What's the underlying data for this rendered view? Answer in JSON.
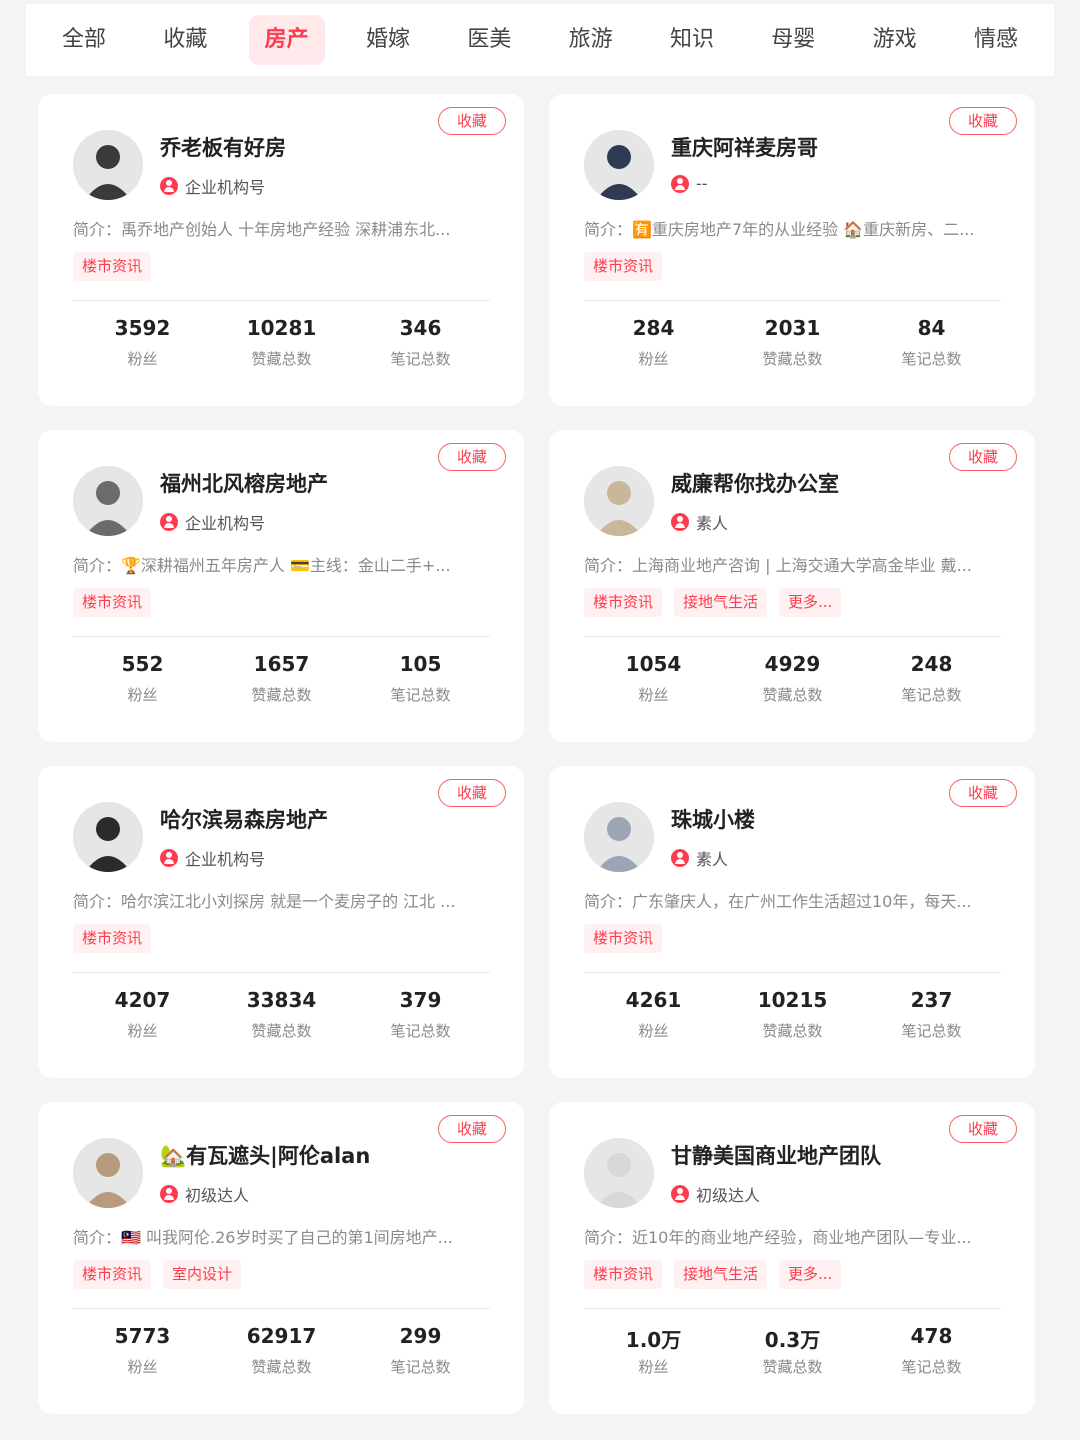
{
  "tabs": [
    "全部",
    "收藏",
    "房产",
    "婚嫁",
    "医美",
    "旅游",
    "知识",
    "母婴",
    "游戏",
    "情感"
  ],
  "active_tab_index": 2,
  "colors": {
    "accent": "#ff3b4e",
    "tag_bg": "#fff0f1",
    "page_bg": "#f4f4f5"
  },
  "collect_label": "收藏",
  "stat_labels": {
    "fans": "粉丝",
    "likes": "赞藏总数",
    "notes": "笔记总数"
  },
  "cards": [
    {
      "name": "乔老板有好房",
      "role": "企业机构号",
      "bio": "简介：禹乔地产创始人 十年房地产经验 深耕浦东北...",
      "tags": [
        "楼市资讯"
      ],
      "fans": "3592",
      "likes": "10281",
      "notes": "346",
      "avatar_color": "#3a3a3a"
    },
    {
      "name": "重庆阿祥麦房哥",
      "role": "--",
      "bio": "简介：🈶重庆房地产7年的从业经验 🏠重庆新房、二...",
      "tags": [
        "楼市资讯"
      ],
      "fans": "284",
      "likes": "2031",
      "notes": "84",
      "avatar_color": "#2f3b52"
    },
    {
      "name": "福州北风榕房地产",
      "role": "企业机构号",
      "bio": "简介：🏆深耕福州五年房产人 💳主线：金山二手+...",
      "tags": [
        "楼市资讯"
      ],
      "fans": "552",
      "likes": "1657",
      "notes": "105",
      "avatar_color": "#6b6b6b"
    },
    {
      "name": "威廉帮你找办公室",
      "role": "素人",
      "bio": "简介：上海商业地产咨询 | 上海交通大学高金毕业 戴...",
      "tags": [
        "楼市资讯",
        "接地气生活",
        "更多..."
      ],
      "fans": "1054",
      "likes": "4929",
      "notes": "248",
      "avatar_color": "#c9b79a"
    },
    {
      "name": "哈尔滨易森房地产",
      "role": "企业机构号",
      "bio": "简介：哈尔滨江北小刘探房 就是一个麦房子的 江北 ...",
      "tags": [
        "楼市资讯"
      ],
      "fans": "4207",
      "likes": "33834",
      "notes": "379",
      "avatar_color": "#2b2b2b"
    },
    {
      "name": "珠城小楼",
      "role": "素人",
      "bio": "简介：广东肇庆人，在广州工作生活超过10年，每天...",
      "tags": [
        "楼市资讯"
      ],
      "fans": "4261",
      "likes": "10215",
      "notes": "237",
      "avatar_color": "#9aa6b3"
    },
    {
      "name": "🏡有瓦遮头|阿伦alan",
      "role": "初级达人",
      "bio": "简介：🇲🇾 叫我阿伦.26岁时买了自己的第1间房地产...",
      "tags": [
        "楼市资讯",
        "室内设计"
      ],
      "fans": "5773",
      "likes": "62917",
      "notes": "299",
      "avatar_color": "#b89a7c"
    },
    {
      "name": "甘静美国商业地产团队",
      "role": "初级达人",
      "bio": "简介：近10年的商业地产经验，商业地产团队—专业...",
      "tags": [
        "楼市资讯",
        "接地气生活",
        "更多..."
      ],
      "fans": "1.0万",
      "likes": "0.3万",
      "notes": "478",
      "avatar_color": "#d8d8d8"
    }
  ]
}
